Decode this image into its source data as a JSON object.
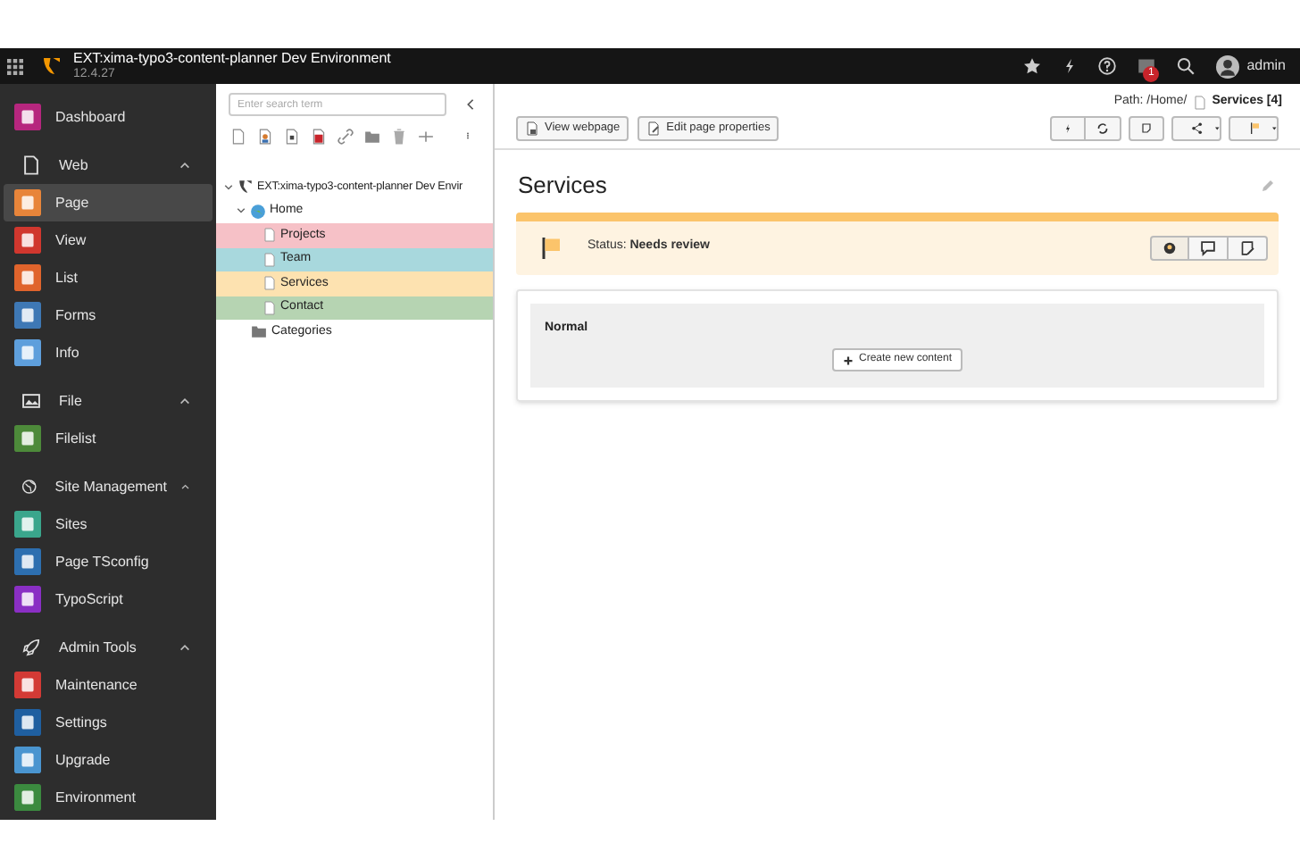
{
  "topbar": {
    "site_title": "EXT:xima-typo3-content-planner Dev Environment",
    "version": "12.4.27",
    "notification_count": "1",
    "user": "admin"
  },
  "sidebar": [
    {
      "kind": "module",
      "label": "Dashboard",
      "color": "#b6267e",
      "selected": false
    },
    {
      "kind": "group",
      "label": "Web",
      "expanded": true,
      "children": [
        {
          "label": "Page",
          "color": "#e8853a",
          "selected": true
        },
        {
          "label": "View",
          "color": "#d0372e",
          "selected": false
        },
        {
          "label": "List",
          "color": "#e0642c",
          "selected": false
        },
        {
          "label": "Forms",
          "color": "#3e78b5",
          "selected": false
        },
        {
          "label": "Info",
          "color": "#5e9fdc",
          "selected": false
        }
      ]
    },
    {
      "kind": "group",
      "label": "File",
      "expanded": true,
      "children": [
        {
          "label": "Filelist",
          "color": "#4d8a3a",
          "selected": false
        }
      ]
    },
    {
      "kind": "group",
      "label": "Site Management",
      "expanded": true,
      "children": [
        {
          "label": "Sites",
          "color": "#3aa68c",
          "selected": false
        },
        {
          "label": "Page TSconfig",
          "color": "#2d6fb0",
          "selected": false
        },
        {
          "label": "TypoScript",
          "color": "#8a2fc4",
          "selected": false
        }
      ]
    },
    {
      "kind": "group",
      "label": "Admin Tools",
      "expanded": true,
      "children": [
        {
          "label": "Maintenance",
          "color": "#d33a35",
          "selected": false
        },
        {
          "label": "Settings",
          "color": "#1f5fa0",
          "selected": false
        },
        {
          "label": "Upgrade",
          "color": "#4a95d0",
          "selected": false
        },
        {
          "label": "Environment",
          "color": "#3b8a3f",
          "selected": false
        }
      ]
    }
  ],
  "page_tree": {
    "search": {
      "placeholder": "Enter search term"
    },
    "root": {
      "label": "EXT:xima-typo3-content-planner Dev Envir",
      "expanded": true,
      "children": [
        {
          "label": "Home",
          "expanded": true,
          "children": [
            {
              "label": "Projects",
              "color": "#f6c1c7"
            },
            {
              "label": "Team",
              "color": "#a8d8dd"
            },
            {
              "label": "Services",
              "color": "#fde2b0"
            },
            {
              "label": "Contact",
              "color": "#b6d4b2"
            }
          ]
        },
        {
          "label": "Categories",
          "kind": "folder"
        }
      ]
    }
  },
  "main": {
    "path": "Path: /Home/",
    "page_label": "Services [4]",
    "buttons": [
      "View webpage",
      "Edit page properties"
    ],
    "title": "Services",
    "status": {
      "text": "Status: **Needs review**",
      "color": "#fbc46b"
    },
    "column": {
      "name": "Normal",
      "button": "Create new content"
    }
  }
}
